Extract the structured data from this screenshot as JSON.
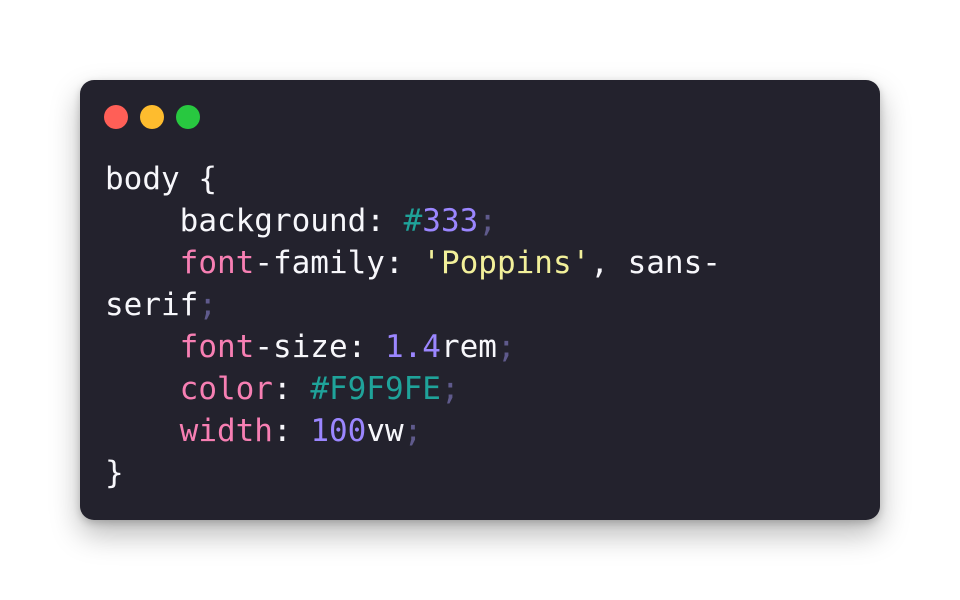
{
  "window": {
    "traffic_lights": [
      {
        "name": "close-button",
        "color": "#ff5f57"
      },
      {
        "name": "minimize-button",
        "color": "#febc2e"
      },
      {
        "name": "zoom-button",
        "color": "#28c840"
      }
    ]
  },
  "code": {
    "lines": [
      {
        "indent": "",
        "tokens": [
          {
            "text": "body {",
            "kind": "text"
          }
        ]
      },
      {
        "indent": "    ",
        "tokens": [
          {
            "text": "background: ",
            "kind": "text"
          },
          {
            "text": "#",
            "kind": "hash"
          },
          {
            "text": "333",
            "kind": "num"
          },
          {
            "text": ";",
            "kind": "semi"
          }
        ]
      },
      {
        "indent": "    ",
        "tokens": [
          {
            "text": "font",
            "kind": "prop"
          },
          {
            "text": "-family: ",
            "kind": "text"
          },
          {
            "text": "'Poppins'",
            "kind": "str"
          },
          {
            "text": ", sans-",
            "kind": "text"
          }
        ]
      },
      {
        "indent": "",
        "tokens": [
          {
            "text": "serif",
            "kind": "text"
          },
          {
            "text": ";",
            "kind": "semi"
          }
        ]
      },
      {
        "indent": "    ",
        "tokens": [
          {
            "text": "font",
            "kind": "prop"
          },
          {
            "text": "-size: ",
            "kind": "text"
          },
          {
            "text": "1.4",
            "kind": "num"
          },
          {
            "text": "rem",
            "kind": "text"
          },
          {
            "text": ";",
            "kind": "semi"
          }
        ]
      },
      {
        "indent": "    ",
        "tokens": [
          {
            "text": "color",
            "kind": "prop"
          },
          {
            "text": ": ",
            "kind": "text"
          },
          {
            "text": "#F9F9FE",
            "kind": "hash"
          },
          {
            "text": ";",
            "kind": "semi"
          }
        ]
      },
      {
        "indent": "    ",
        "tokens": [
          {
            "text": "width",
            "kind": "prop"
          },
          {
            "text": ": ",
            "kind": "text"
          },
          {
            "text": "100",
            "kind": "num"
          },
          {
            "text": "vw",
            "kind": "text"
          },
          {
            "text": ";",
            "kind": "semi"
          }
        ]
      },
      {
        "indent": "",
        "tokens": [
          {
            "text": "}",
            "kind": "text"
          }
        ]
      }
    ]
  }
}
